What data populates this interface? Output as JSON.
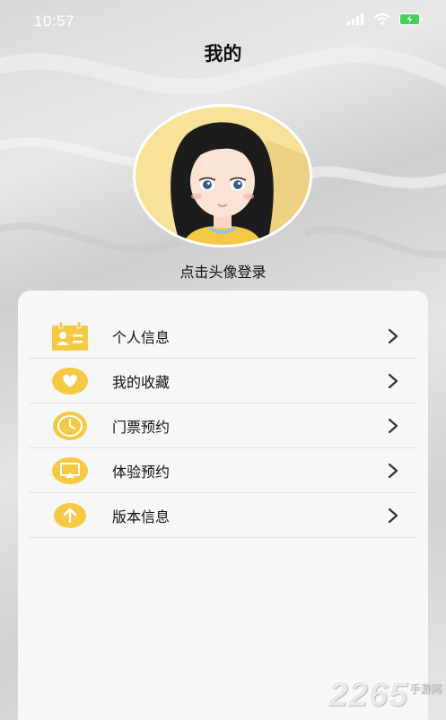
{
  "status_bar": {
    "time": "10:57"
  },
  "header": {
    "title": "我的"
  },
  "profile": {
    "login_prompt": "点击头像登录"
  },
  "menu": {
    "items": [
      {
        "label": "个人信息",
        "icon": "id-card-icon"
      },
      {
        "label": "我的收藏",
        "icon": "heart-icon"
      },
      {
        "label": "门票预约",
        "icon": "clock-icon"
      },
      {
        "label": "体验预约",
        "icon": "screen-icon"
      },
      {
        "label": "版本信息",
        "icon": "upload-arrow-icon"
      }
    ]
  },
  "watermark": {
    "number": "2265",
    "text": "手游网"
  },
  "colors": {
    "accent": "#f6c945",
    "background": "#dcdcdc",
    "card": "#f7f7f7"
  }
}
